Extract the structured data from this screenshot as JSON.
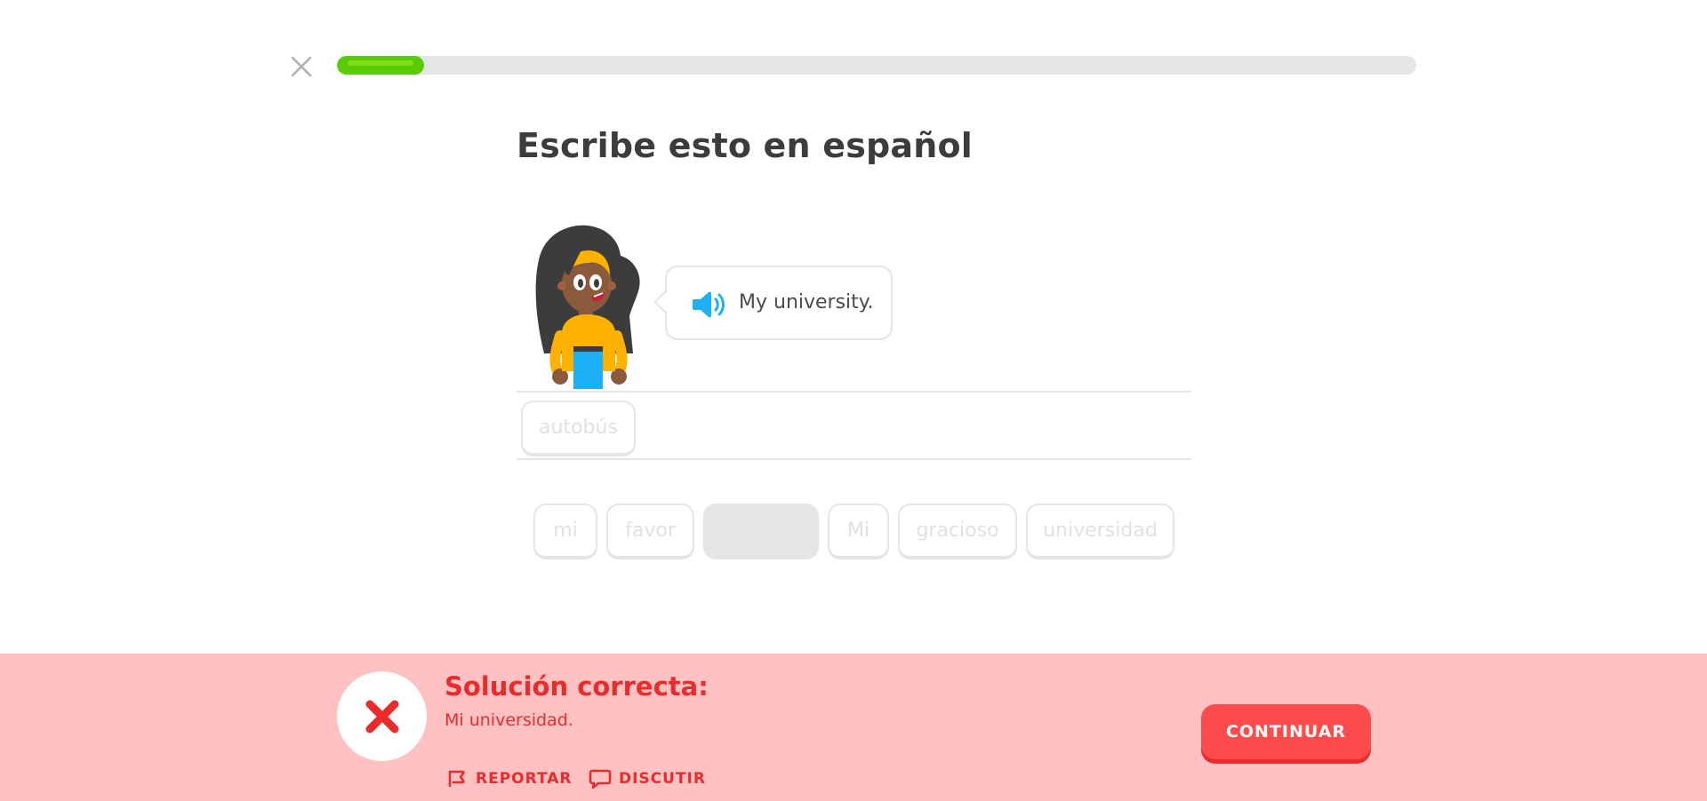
{
  "progress": {
    "fraction": 0.081
  },
  "challenge": {
    "title": "Escribe esto en español"
  },
  "prompt": {
    "text": "My university."
  },
  "answer_area": {
    "tokens": [
      "autobús"
    ]
  },
  "word_bank": {
    "tokens": [
      "mi",
      "favor",
      "",
      "Mi",
      "gracioso",
      "universidad"
    ]
  },
  "footer": {
    "title": "Solución correcta:",
    "solution": "Mi universidad.",
    "report_label": "REPORTAR",
    "discuss_label": "DISCUTIR",
    "continue_label": "CONTINUAR"
  },
  "colors": {
    "progress_green": "#58cc02",
    "error_red": "#ea2b2b",
    "footer_bg": "#ffc1c1",
    "speaker_blue": "#1cb0f6",
    "continue_bg": "#ff4b4b"
  },
  "icons": {
    "close": "close-icon",
    "speaker": "speaker-icon",
    "status": "red-x-icon",
    "report": "flag-icon",
    "discuss": "chat-bubble-icon"
  }
}
